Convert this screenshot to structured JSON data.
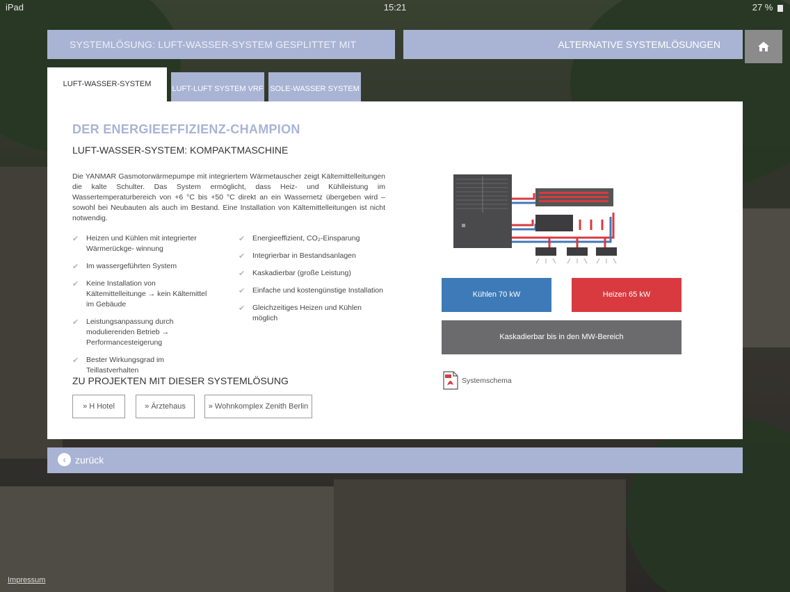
{
  "status_bar": {
    "device": "iPad",
    "time": "15:21",
    "battery": "27 %"
  },
  "header": {
    "title": "SYSTEMLÖSUNG: LUFT-WASSER-SYSTEM GESPLITTET MIT HYDROBOX",
    "alternatives": "ALTERNATIVE SYSTEMLÖSUNGEN",
    "home_icon": "home-icon"
  },
  "tabs": [
    {
      "label": "LUFT-WASSER-SYSTEM KOMPAKT",
      "active": true
    },
    {
      "label": "LUFT-LUFT SYSTEM VRF",
      "active": false
    },
    {
      "label": "SOLE-WASSER SYSTEM",
      "active": false
    }
  ],
  "content": {
    "headline": "DER ENERGIEEFFIZIENZ-CHAMPION",
    "subheadline": "LUFT-WASSER-SYSTEM: KOMPAKTMASCHINE",
    "intro": "Die YANMAR Gasmotorwärmepumpe mit integriertem Wärmetauscher zeigt Kältemittelleitungen die kalte Schulter. Das System ermöglicht, dass Heiz- und Kühlleistung im Wassertemperaturbereich von +6 °C bis +50 °C direkt an ein Wassernetz übergeben wird – sowohl bei Neubauten als auch im Bestand. Eine Installation von Kältemittelleitungen ist nicht notwendig.",
    "features_left": [
      "Heizen und Kühlen mit integrierter Wärmerückge- winnung",
      "Im wassergeführten System",
      "Keine Installation von Kältemittelleitunge → kein Kältemittel im Gebäude",
      "Leistungsanpassung durch modulierenden Betrieb → Performancesteigerung",
      "Bester Wirkungsgrad im Teillastverhalten"
    ],
    "features_right": [
      "Energieeffizient, CO₂-Einsparung",
      "Integrierbar in Bestandsanlagen",
      "Kaskadierbar (große Leistung)",
      "Einfache und kostengünstige Installation",
      "Gleichzeitiges Heizen und Kühlen möglich"
    ],
    "projects_title": "ZU PROJEKTEN MIT DIESER SYSTEMLÖSUNG",
    "projects": [
      "» H Hotel",
      "» Ärztehaus",
      "» Wohnkomplex Zenith Berlin"
    ],
    "cooling": "Kühlen 70 kW",
    "heating": "Heizen 65 kW",
    "cascade": "Kaskadierbar bis in den MW-Bereich",
    "pdf_label": "Systemschema",
    "colors": {
      "accent": "#a9b4d4",
      "cooling": "#3f7ab8",
      "heating": "#d83a40",
      "cascade": "#6b6b6d"
    }
  },
  "footer": {
    "back": "zurück",
    "impressum": "Impressum"
  }
}
